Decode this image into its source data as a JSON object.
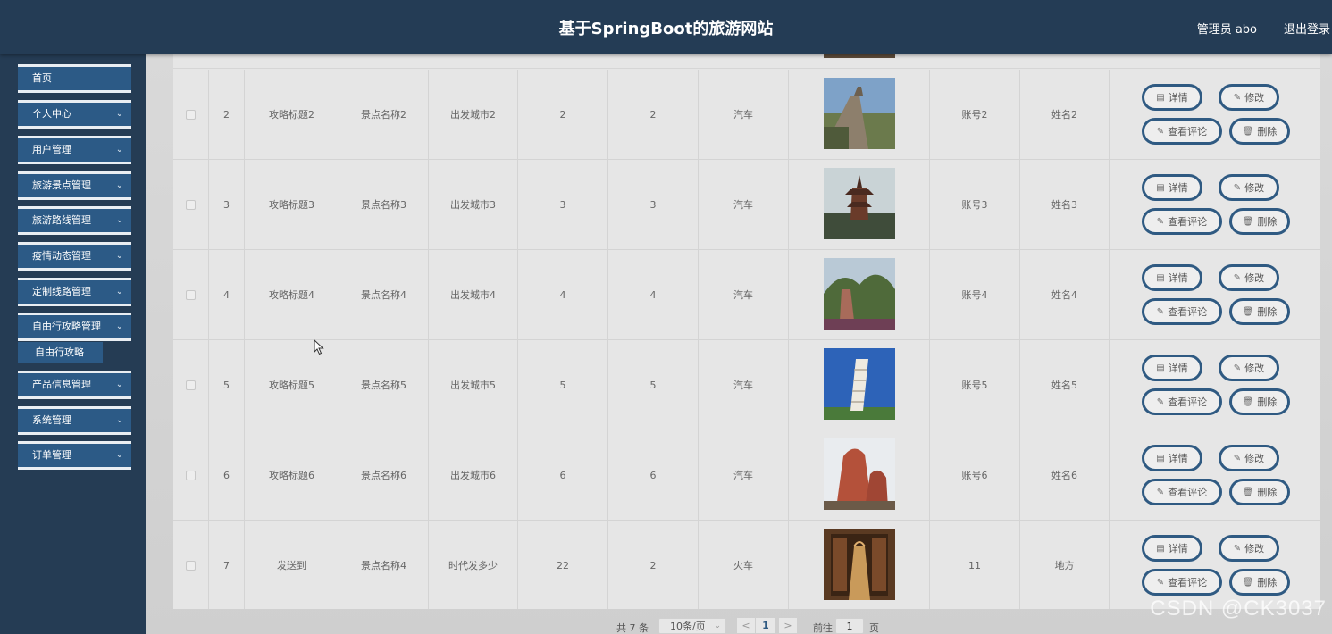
{
  "header": {
    "title": "基于SpringBoot的旅游网站",
    "user": "管理员 abo",
    "logout": "退出登录"
  },
  "sidebar": {
    "items": [
      {
        "label": "首页",
        "has_arrow": false
      },
      {
        "label": "个人中心",
        "has_arrow": true
      },
      {
        "label": "用户管理",
        "has_arrow": true
      },
      {
        "label": "旅游景点管理",
        "has_arrow": true
      },
      {
        "label": "旅游路线管理",
        "has_arrow": true
      },
      {
        "label": "疫情动态管理",
        "has_arrow": true
      },
      {
        "label": "定制线路管理",
        "has_arrow": true
      },
      {
        "label": "自由行攻略管理",
        "has_arrow": true
      },
      {
        "label": "产品信息管理",
        "has_arrow": true
      },
      {
        "label": "系统管理",
        "has_arrow": true
      },
      {
        "label": "订单管理",
        "has_arrow": true
      }
    ],
    "submenu": {
      "label": "自由行攻略"
    }
  },
  "table": {
    "rows": [
      {
        "index": "2",
        "title": "攻略标题2",
        "scenic": "景点名称2",
        "city": "出发城市2",
        "col5": "2",
        "col6": "2",
        "transport": "汽车",
        "image": "great-wall",
        "account": "账号2",
        "name": "姓名2"
      },
      {
        "index": "3",
        "title": "攻略标题3",
        "scenic": "景点名称3",
        "city": "出发城市3",
        "col5": "3",
        "col6": "3",
        "transport": "汽车",
        "image": "pagoda",
        "account": "账号3",
        "name": "姓名3"
      },
      {
        "index": "4",
        "title": "攻略标题4",
        "scenic": "景点名称4",
        "city": "出发城市4",
        "col5": "4",
        "col6": "4",
        "transport": "汽车",
        "image": "mountain",
        "account": "账号4",
        "name": "姓名4"
      },
      {
        "index": "5",
        "title": "攻略标题5",
        "scenic": "景点名称5",
        "city": "出发城市5",
        "col5": "5",
        "col6": "5",
        "transport": "汽车",
        "image": "leaning-tower",
        "account": "账号5",
        "name": "姓名5"
      },
      {
        "index": "6",
        "title": "攻略标题6",
        "scenic": "景点名称6",
        "city": "出发城市6",
        "col5": "6",
        "col6": "6",
        "transport": "汽车",
        "image": "red-rock",
        "account": "账号6",
        "name": "姓名6"
      },
      {
        "index": "7",
        "title": "发送到",
        "scenic": "景点名称4",
        "city": "时代发多少",
        "col5": "22",
        "col6": "2",
        "transport": "火车",
        "image": "library",
        "account": "11",
        "name": "地方"
      }
    ],
    "actions": {
      "detail": "详情",
      "edit": "修改",
      "comments": "查看评论",
      "delete": "删除"
    },
    "icons": {
      "detail": "document-icon",
      "edit": "pencil-icon",
      "comments": "pencil-icon",
      "delete": "trash-icon"
    }
  },
  "pagination": {
    "total": "共 7 条",
    "page_size": "10条/页",
    "prev": "<",
    "current": "1",
    "next": ">",
    "goto_label": "前往",
    "goto_value": "1",
    "page_label": "页"
  },
  "watermark": "CSDN @CK3037"
}
